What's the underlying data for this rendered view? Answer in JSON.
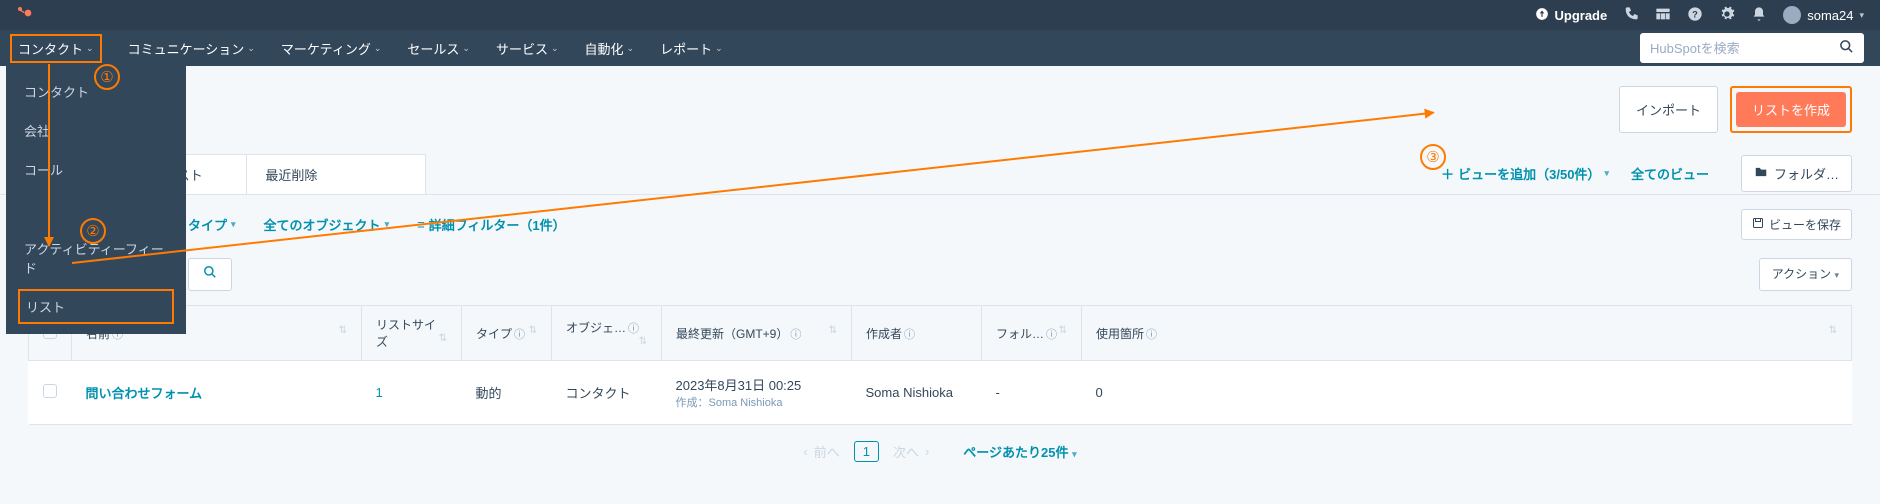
{
  "topbar": {
    "upgrade": "Upgrade",
    "username": "soma24"
  },
  "nav": {
    "contacts": "コンタクト",
    "communication": "コミュニケーション",
    "marketing": "マーケティング",
    "sales": "セールス",
    "service": "サービス",
    "automation": "自動化",
    "report": "レポート"
  },
  "search": {
    "placeholder": "HubSpotを検索"
  },
  "dropdown": {
    "contacts": "コンタクト",
    "companies": "会社",
    "calls": "コール",
    "activity": "アクティビティーフィード",
    "lists": "リスト"
  },
  "buttons": {
    "import": "インポート",
    "create_list": "リストを作成",
    "folder": "フォルダ…",
    "save_view": "ビューを保存",
    "actions": "アクション"
  },
  "tabs": {
    "unused": "使っていないリスト",
    "recent_delete": "最近削除",
    "add_view": "ビューを追加（3/50件）",
    "all_views": "全てのビュー"
  },
  "filters": {
    "type": "タイプ",
    "all_objects": "全てのオブジェクト",
    "advanced": "詳細フィルター（1件）"
  },
  "columns": {
    "name": "名前",
    "size": "リストサイズ",
    "type": "タイプ",
    "object": "オブジェ…",
    "updated": "最終更新（GMT+9）",
    "creator": "作成者",
    "folder": "フォル…",
    "usage": "使用箇所"
  },
  "rows": [
    {
      "name": "問い合わせフォーム",
      "size": "1",
      "type": "動的",
      "object": "コンタクト",
      "updated": "2023年8月31日 00:25",
      "updated_sub": "作成：Soma Nishioka",
      "creator": "Soma Nishioka",
      "folder": "-",
      "usage": "0"
    }
  ],
  "pagination": {
    "prev": "前へ",
    "page": "1",
    "next": "次へ",
    "per_page": "ページあたり25件"
  }
}
